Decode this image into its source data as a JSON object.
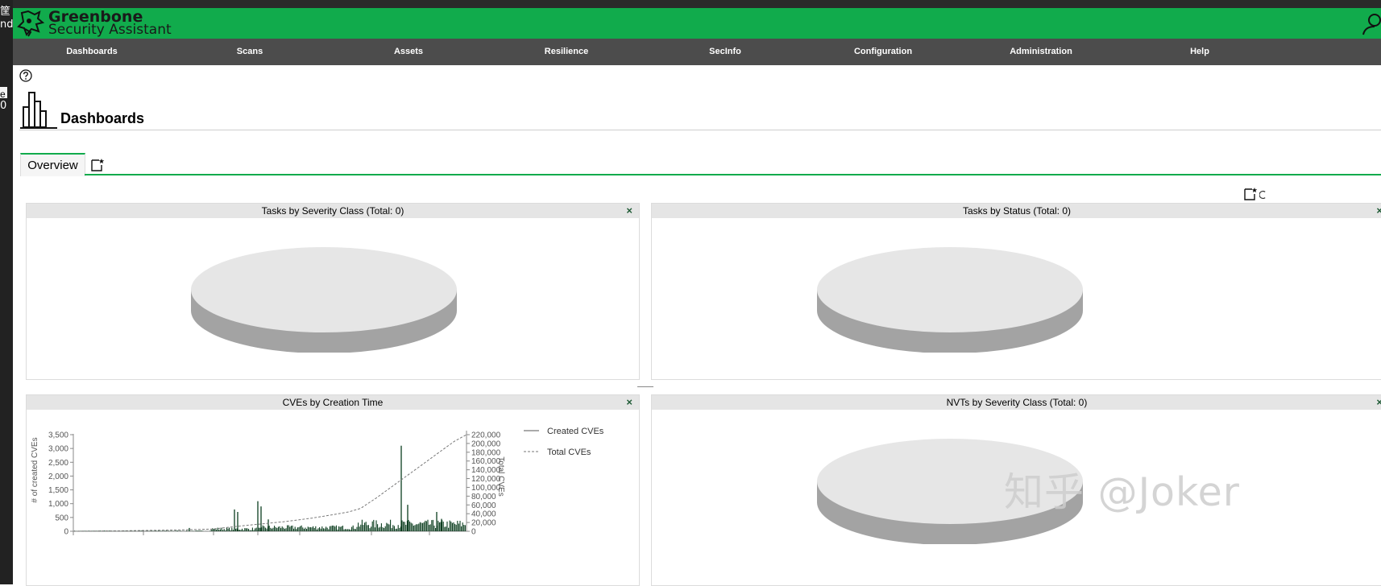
{
  "brand": {
    "name": "Greenbone",
    "subtitle": "Security Assistant"
  },
  "nav": {
    "items": [
      "Dashboards",
      "Scans",
      "Assets",
      "Resilience",
      "SecInfo",
      "Configuration",
      "Administration",
      "Help"
    ]
  },
  "page": {
    "title": "Dashboards"
  },
  "tabs": [
    {
      "label": "Overview"
    }
  ],
  "panels": [
    {
      "title": "Tasks by Severity Class (Total: 0)",
      "close": "×"
    },
    {
      "title": "Tasks by Status (Total: 0)",
      "close": "×"
    },
    {
      "title": "CVEs by Creation Time",
      "close": "×"
    },
    {
      "title": "NVTs by Severity Class (Total: 0)",
      "close": "×"
    }
  ],
  "left_strip": {
    "texts": [
      "筐",
      "nd",
      "e",
      "0"
    ]
  },
  "watermark": "知乎 @Joker",
  "colors": {
    "brand_green": "#11ab4c",
    "nav_dark": "#4c4c4c",
    "panel_header": "#e5e5e5",
    "bar_dark_green": "#0a3d1e"
  },
  "chart_data": {
    "type": "bar",
    "title": "CVEs by Creation Time",
    "y_left": {
      "label": "# of created CVEs",
      "ticks": [
        "3,500",
        "3,000",
        "2,500",
        "2,000",
        "1,500",
        "1,000",
        "500",
        "0"
      ],
      "range": [
        0,
        3500
      ]
    },
    "y_right": {
      "label": "Total CVEs",
      "ticks": [
        "220,000",
        "200,000",
        "180,000",
        "160,000",
        "140,000",
        "120,000",
        "100,000",
        "80,000",
        "60,000",
        "40,000",
        "20,000",
        "0"
      ],
      "range": [
        0,
        220000
      ]
    },
    "series": [
      {
        "name": "Created CVEs",
        "type": "bar",
        "max_value": 3100
      },
      {
        "name": "Total CVEs",
        "type": "line",
        "style": "dashed",
        "values": [
          [
            0,
            0
          ],
          [
            15,
            1000
          ],
          [
            35,
            3000
          ],
          [
            46,
            5000
          ],
          [
            50,
            8000
          ],
          [
            58,
            14000
          ],
          [
            70,
            22000
          ],
          [
            79,
            30000
          ],
          [
            86,
            38000
          ],
          [
            91,
            44000
          ],
          [
            95,
            52000
          ],
          [
            98,
            66000
          ],
          [
            100,
            75000
          ],
          [
            104,
            95000
          ],
          [
            108,
            115000
          ],
          [
            112,
            135000
          ],
          [
            116,
            155000
          ],
          [
            121,
            180000
          ],
          [
            126,
            205000
          ],
          [
            130,
            220000
          ]
        ]
      }
    ],
    "legend": {
      "position": "right",
      "entries": [
        "Created CVEs",
        "Total CVEs"
      ]
    }
  }
}
